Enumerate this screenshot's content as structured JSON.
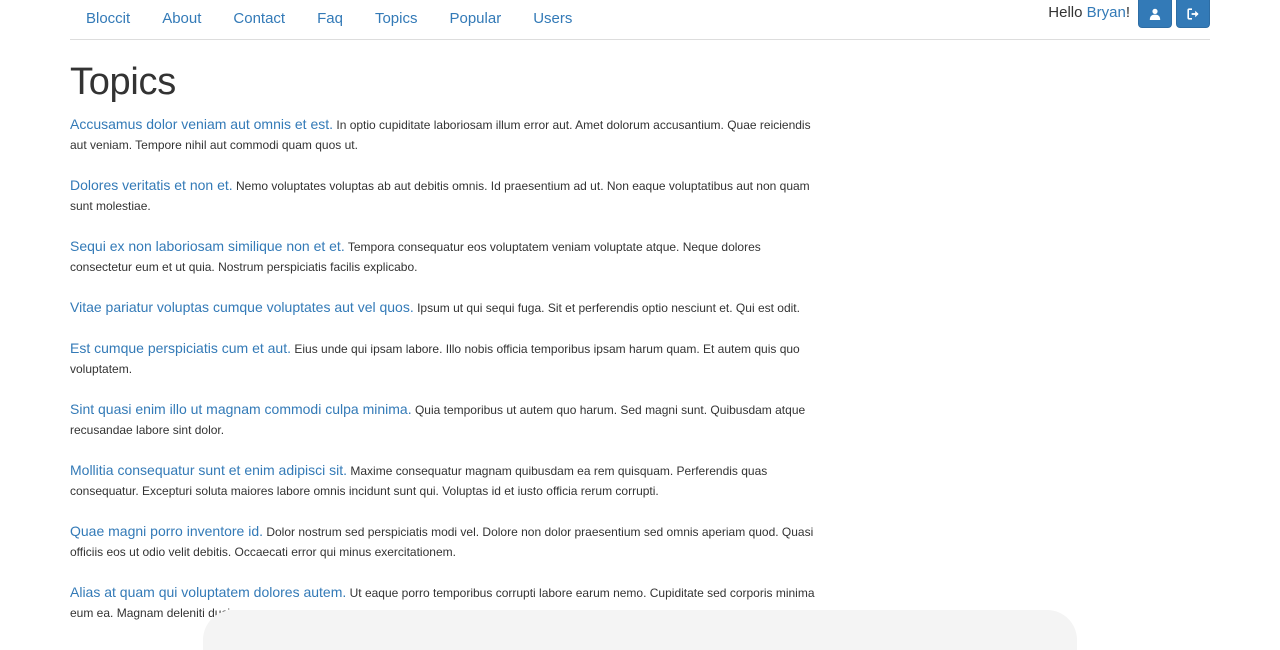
{
  "nav": {
    "links": [
      "Bloccit",
      "About",
      "Contact",
      "Faq",
      "Topics",
      "Popular",
      "Users"
    ],
    "greeting_prefix": "Hello ",
    "user_name": "Bryan",
    "greeting_suffix": "!",
    "profile_icon": "user-icon",
    "signout_icon": "sign-out-icon",
    "accent_color": "#337ab7"
  },
  "main": {
    "title": "Topics",
    "topics": [
      {
        "title": "Accusamus dolor veniam aut omnis et est.",
        "description": "In optio cupiditate laboriosam illum error aut. Amet dolorum accusantium. Quae reiciendis aut veniam. Tempore nihil aut commodi quam quos ut."
      },
      {
        "title": "Dolores veritatis et non et.",
        "description": "Nemo voluptates voluptas ab aut debitis omnis. Id praesentium ad ut. Non eaque voluptatibus aut non quam sunt molestiae."
      },
      {
        "title": "Sequi ex non laboriosam similique non et et.",
        "description": "Tempora consequatur eos voluptatem veniam voluptate atque. Neque dolores consectetur eum et ut quia. Nostrum perspiciatis facilis explicabo."
      },
      {
        "title": "Vitae pariatur voluptas cumque voluptates aut vel quos.",
        "description": "Ipsum ut qui sequi fuga. Sit et perferendis optio nesciunt et. Qui est odit."
      },
      {
        "title": "Est cumque perspiciatis cum et aut.",
        "description": "Eius unde qui ipsam labore. Illo nobis officia temporibus ipsam harum quam. Et autem quis quo voluptatem."
      },
      {
        "title": "Sint quasi enim illo ut magnam commodi culpa minima.",
        "description": "Quia temporibus ut autem quo harum. Sed magni sunt. Quibusdam atque recusandae labore sint dolor."
      },
      {
        "title": "Mollitia consequatur sunt et enim adipisci sit.",
        "description": "Maxime consequatur magnam quibusdam ea rem quisquam. Perferendis quas consequatur. Excepturi soluta maiores labore omnis incidunt sunt qui. Voluptas id et iusto officia rerum corrupti."
      },
      {
        "title": "Quae magni porro inventore id.",
        "description": "Dolor nostrum sed perspiciatis modi vel. Dolore non dolor praesentium sed omnis aperiam quod. Quasi officiis eos ut odio velit debitis. Occaecati error qui minus exercitationem."
      },
      {
        "title": "Alias at quam qui voluptatem dolores autem.",
        "description": "Ut eaque porro temporibus corrupti labore earum nemo. Cupiditate sed corporis minima eum ea. Magnam deleniti ducimus."
      }
    ]
  }
}
